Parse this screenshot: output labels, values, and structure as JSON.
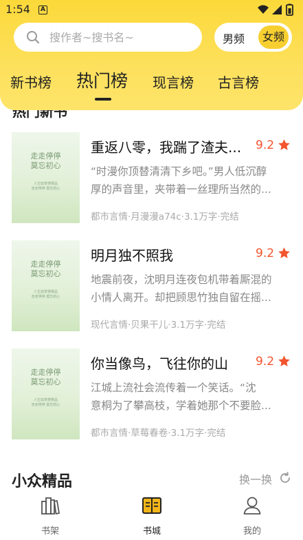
{
  "status": {
    "time": "1:54",
    "notif_letter": "A"
  },
  "search": {
    "placeholder": "搜作者~搜书名~",
    "value": ""
  },
  "gender": {
    "male": "男频",
    "female": "女频",
    "selected": "female"
  },
  "tabs": [
    {
      "label": "新书榜",
      "active": false
    },
    {
      "label": "热门榜",
      "active": true
    },
    {
      "label": "现言榜",
      "active": false
    },
    {
      "label": "古言榜",
      "active": false
    }
  ],
  "peek_section_title": "热门新书",
  "cover": {
    "title_line1": "走走停停",
    "title_line2": "莫忘初心",
    "small_line1": "人生如茶慢慢品",
    "small_line2": "走走停停 莫忘初心"
  },
  "books": [
    {
      "title": "重返八零，我踹了渣夫...",
      "score": "9.2",
      "desc_line1": "“时漫你顶替清清下乡吧。”男人低沉醇",
      "desc_line2": "厚的声音里，夹带着一丝理所当然的...",
      "meta": "都市言情·月漫漫a74c·3.1万字·完结"
    },
    {
      "title": "明月独不照我",
      "score": "9.2",
      "desc_line1": "地震前夜，沈明月连夜包机带着厮混的",
      "desc_line2": "小情人离开。却把顾思竹独自留在摇...",
      "meta": "现代言情·贝果干儿·3.1万字·完结"
    },
    {
      "title": "你当像鸟，飞往你的山",
      "score": "9.2",
      "desc_line1": "江城上流社会流传着一个笑话。“沈",
      "desc_line2": "意桐为了攀高枝，学着她那个不要脸...",
      "meta": "都市言情·草莓春卷·3.1万字·完结"
    }
  ],
  "section2": {
    "title": "小众精品",
    "refresh_label": "换一换"
  },
  "nav": [
    {
      "label": "书架",
      "icon": "bookshelf-icon",
      "active": false
    },
    {
      "label": "书城",
      "icon": "book-open-icon",
      "active": true
    },
    {
      "label": "我的",
      "icon": "user-icon",
      "active": false
    }
  ],
  "colors": {
    "accent": "#fcd93a",
    "score": "#f2542d",
    "active_icon": "#f2b51a"
  }
}
